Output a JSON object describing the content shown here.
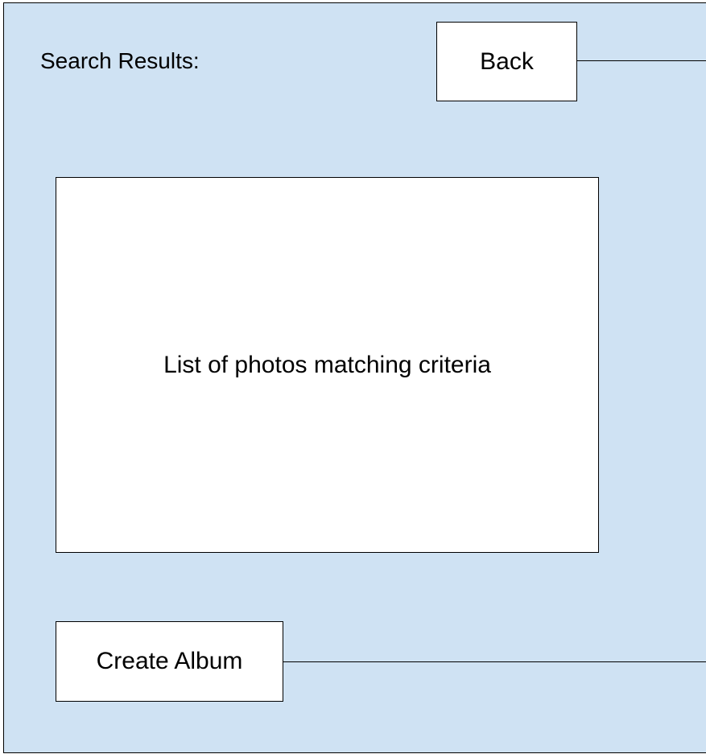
{
  "screen": {
    "title": "Search Results:",
    "back_button_label": "Back",
    "photo_list_label": "List of photos matching criteria",
    "create_album_button_label": "Create Album"
  },
  "colors": {
    "background": "#cfe2f3",
    "box_fill": "#ffffff",
    "stroke": "#000000"
  }
}
